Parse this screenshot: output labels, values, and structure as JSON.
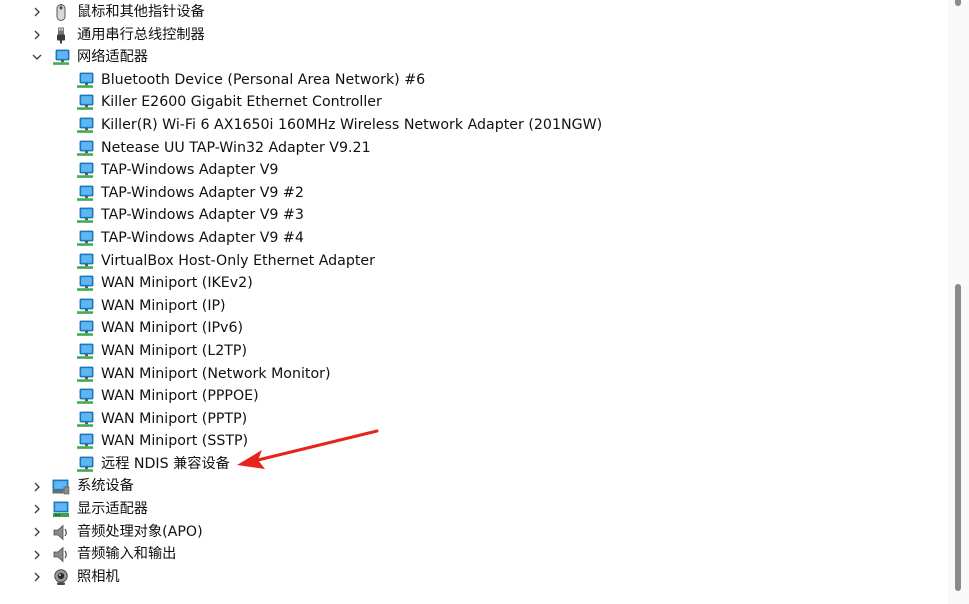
{
  "tree": {
    "categories_top": [
      {
        "label": "鼠标和其他指针设备",
        "icon": "mouse-icon",
        "expanded": false
      },
      {
        "label": "通用串行总线控制器",
        "icon": "usb-plug-icon",
        "expanded": false
      },
      {
        "label": "网络适配器",
        "icon": "network-adapter-icon",
        "expanded": true
      }
    ],
    "network_adapters": [
      {
        "label": "Bluetooth Device (Personal Area Network) #6",
        "icon": "network-adapter-icon"
      },
      {
        "label": "Killer E2600 Gigabit Ethernet Controller",
        "icon": "network-adapter-icon"
      },
      {
        "label": "Killer(R) Wi-Fi 6 AX1650i 160MHz Wireless Network Adapter (201NGW)",
        "icon": "network-adapter-icon"
      },
      {
        "label": "Netease UU TAP-Win32 Adapter V9.21",
        "icon": "network-adapter-icon"
      },
      {
        "label": "TAP-Windows Adapter V9",
        "icon": "network-adapter-icon"
      },
      {
        "label": "TAP-Windows Adapter V9 #2",
        "icon": "network-adapter-icon"
      },
      {
        "label": "TAP-Windows Adapter V9 #3",
        "icon": "network-adapter-icon"
      },
      {
        "label": "TAP-Windows Adapter V9 #4",
        "icon": "network-adapter-icon"
      },
      {
        "label": "VirtualBox Host-Only Ethernet Adapter",
        "icon": "network-adapter-icon"
      },
      {
        "label": "WAN Miniport (IKEv2)",
        "icon": "network-adapter-icon"
      },
      {
        "label": "WAN Miniport (IP)",
        "icon": "network-adapter-icon"
      },
      {
        "label": "WAN Miniport (IPv6)",
        "icon": "network-adapter-icon"
      },
      {
        "label": "WAN Miniport (L2TP)",
        "icon": "network-adapter-icon"
      },
      {
        "label": "WAN Miniport (Network Monitor)",
        "icon": "network-adapter-icon"
      },
      {
        "label": "WAN Miniport (PPPOE)",
        "icon": "network-adapter-icon"
      },
      {
        "label": "WAN Miniport (PPTP)",
        "icon": "network-adapter-icon"
      },
      {
        "label": "WAN Miniport (SSTP)",
        "icon": "network-adapter-icon"
      },
      {
        "label": "远程 NDIS 兼容设备",
        "icon": "network-adapter-icon"
      }
    ],
    "categories_bottom": [
      {
        "label": "系统设备",
        "icon": "system-devices-icon",
        "expanded": false
      },
      {
        "label": "显示适配器",
        "icon": "display-adapter-icon",
        "expanded": false
      },
      {
        "label": "音频处理对象(APO)",
        "icon": "speaker-icon",
        "expanded": false
      },
      {
        "label": "音频输入和输出",
        "icon": "speaker-icon",
        "expanded": false
      },
      {
        "label": "照相机",
        "icon": "camera-icon",
        "expanded": false
      }
    ]
  },
  "annotation": {
    "arrow_color": "#e8231d",
    "points_to": "远程 NDIS 兼容设备"
  },
  "colors": {
    "text": "#111111",
    "monitor_blue": "#1e8ad6",
    "monitor_green": "#3aa64a",
    "scroll_thumb": "#8a8a8a"
  }
}
